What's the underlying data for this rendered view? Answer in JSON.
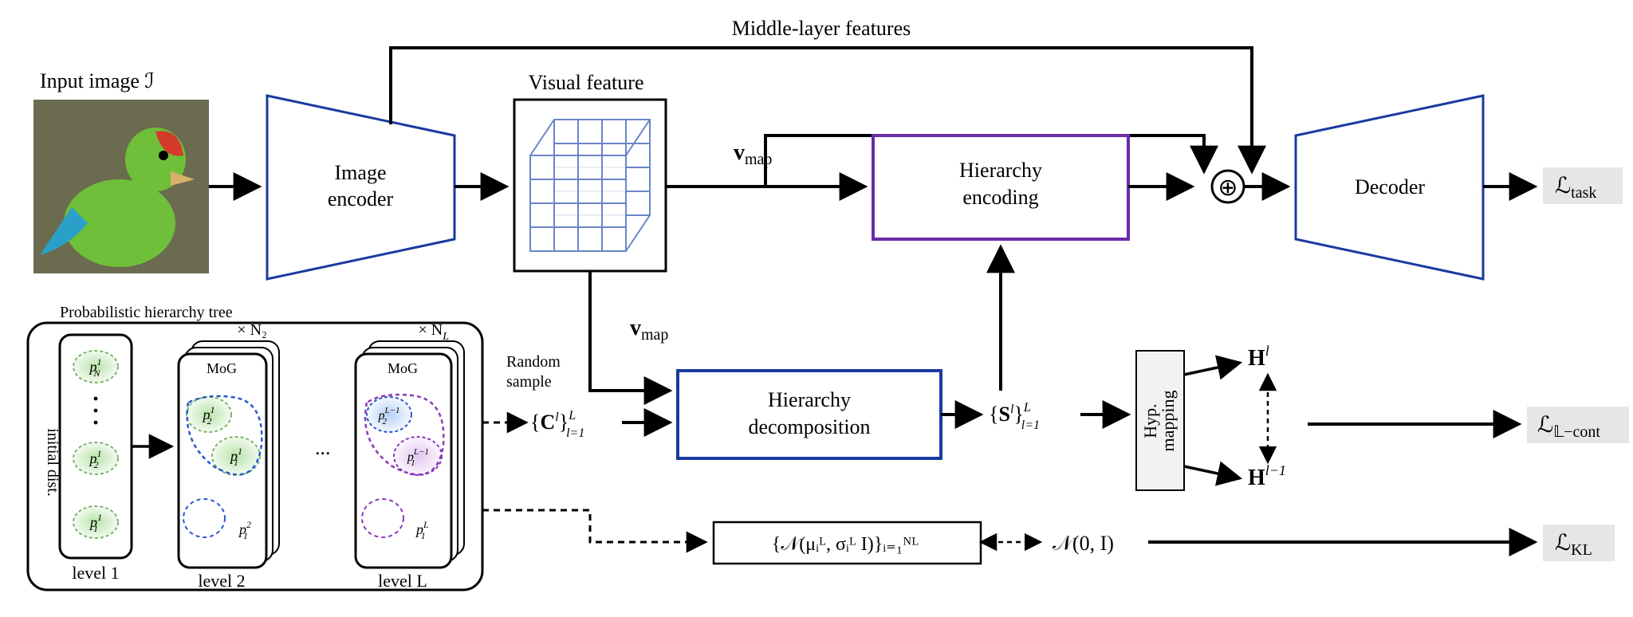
{
  "labels": {
    "input_image": "Input image ℐ",
    "visual_feature": "Visual feature",
    "middle_layer": "Middle-layer features",
    "image_encoder_l1": "Image",
    "image_encoder_l2": "encoder",
    "hierarchy_encoding_l1": "Hierarchy",
    "hierarchy_encoding_l2": "encoding",
    "decoder": "Decoder",
    "vmap": "v",
    "vmap_sub": "map",
    "tree_title": "Probabilistic hierarchy tree",
    "initial_dist": "initial dist.",
    "mog": "MoG",
    "xN2": "× N₂",
    "xNL": "× N",
    "xNL_sub": "L",
    "level1": "level 1",
    "level2": "level 2",
    "levelL": "level L",
    "random_sample_l1": "Random",
    "random_sample_l2": "sample",
    "hier_decomp_l1": "Hierarchy",
    "hier_decomp_l2": "decomposition",
    "hyp_map_l1": "Hyp.",
    "hyp_map_l2": "mapping",
    "ellipsis": "...",
    "plus": "⊕",
    "Hl": "H",
    "Hl_sup": "l",
    "Hl1_sup": "l−1",
    "Cl": "{Cₗ}",
    "Cl_range": "L",
    "Cl_range2": "l=1",
    "Sl": "{Sₗ}",
    "loss_task": "ℒ",
    "loss_task_sub": "task",
    "loss_cont_sub": "𝕃−cont",
    "loss_kl_sub": "KL",
    "kl_box": "{𝒩(μᵢᴸ, σᵢᴸ I)}ᵢ₌₁ᴺᴸ",
    "prior": "𝒩(0, I)",
    "p_nodes": {
      "pN1": "p",
      "pN1_sub": "N",
      "pN1_sup": "1",
      "p21": "p",
      "p21_sub": "2",
      "p21_sup": "1",
      "p11": "p",
      "p11_sub": "1",
      "p11_sup": "1",
      "p21b": "p",
      "p21b_sub": "2",
      "p21b_sup": "1",
      "p11b": "p",
      "p11b_sub": "1",
      "p11b_sup": "1",
      "p12": "p",
      "p12_sub": "1",
      "p12_sup": "2",
      "p2L1": "p",
      "p2L1_sub": "2",
      "p2L1_sup": "L−1",
      "p1L1": "p",
      "p1L1_sub": "1",
      "p1L1_sup": "L−1",
      "p1L": "p",
      "p1L_sub": "1",
      "p1L_sup": "L"
    }
  }
}
